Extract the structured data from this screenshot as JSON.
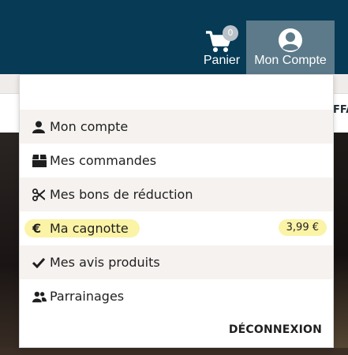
{
  "header": {
    "cart_count": "0",
    "cart_label": "Panier",
    "account_label": "Mon Compte",
    "nav_peek_text": "FFA"
  },
  "menu": {
    "items": [
      {
        "label": "Mon compte",
        "icon": "user-icon"
      },
      {
        "label": "Mes commandes",
        "icon": "box-icon"
      },
      {
        "label": "Mes bons de réduction",
        "icon": "scissors-icon"
      },
      {
        "label": "Ma cagnotte",
        "icon": "euro-icon",
        "amount": "3,99 €"
      },
      {
        "label": "Mes avis produits",
        "icon": "check-icon"
      },
      {
        "label": "Parrainages",
        "icon": "users-icon"
      }
    ],
    "logout_label": "DÉCONNEXION"
  },
  "colors": {
    "header_bg": "#063a55",
    "account_bg": "#5c7a8a",
    "highlight": "#fbf3a6",
    "alt_row": "#f6f2f0"
  }
}
